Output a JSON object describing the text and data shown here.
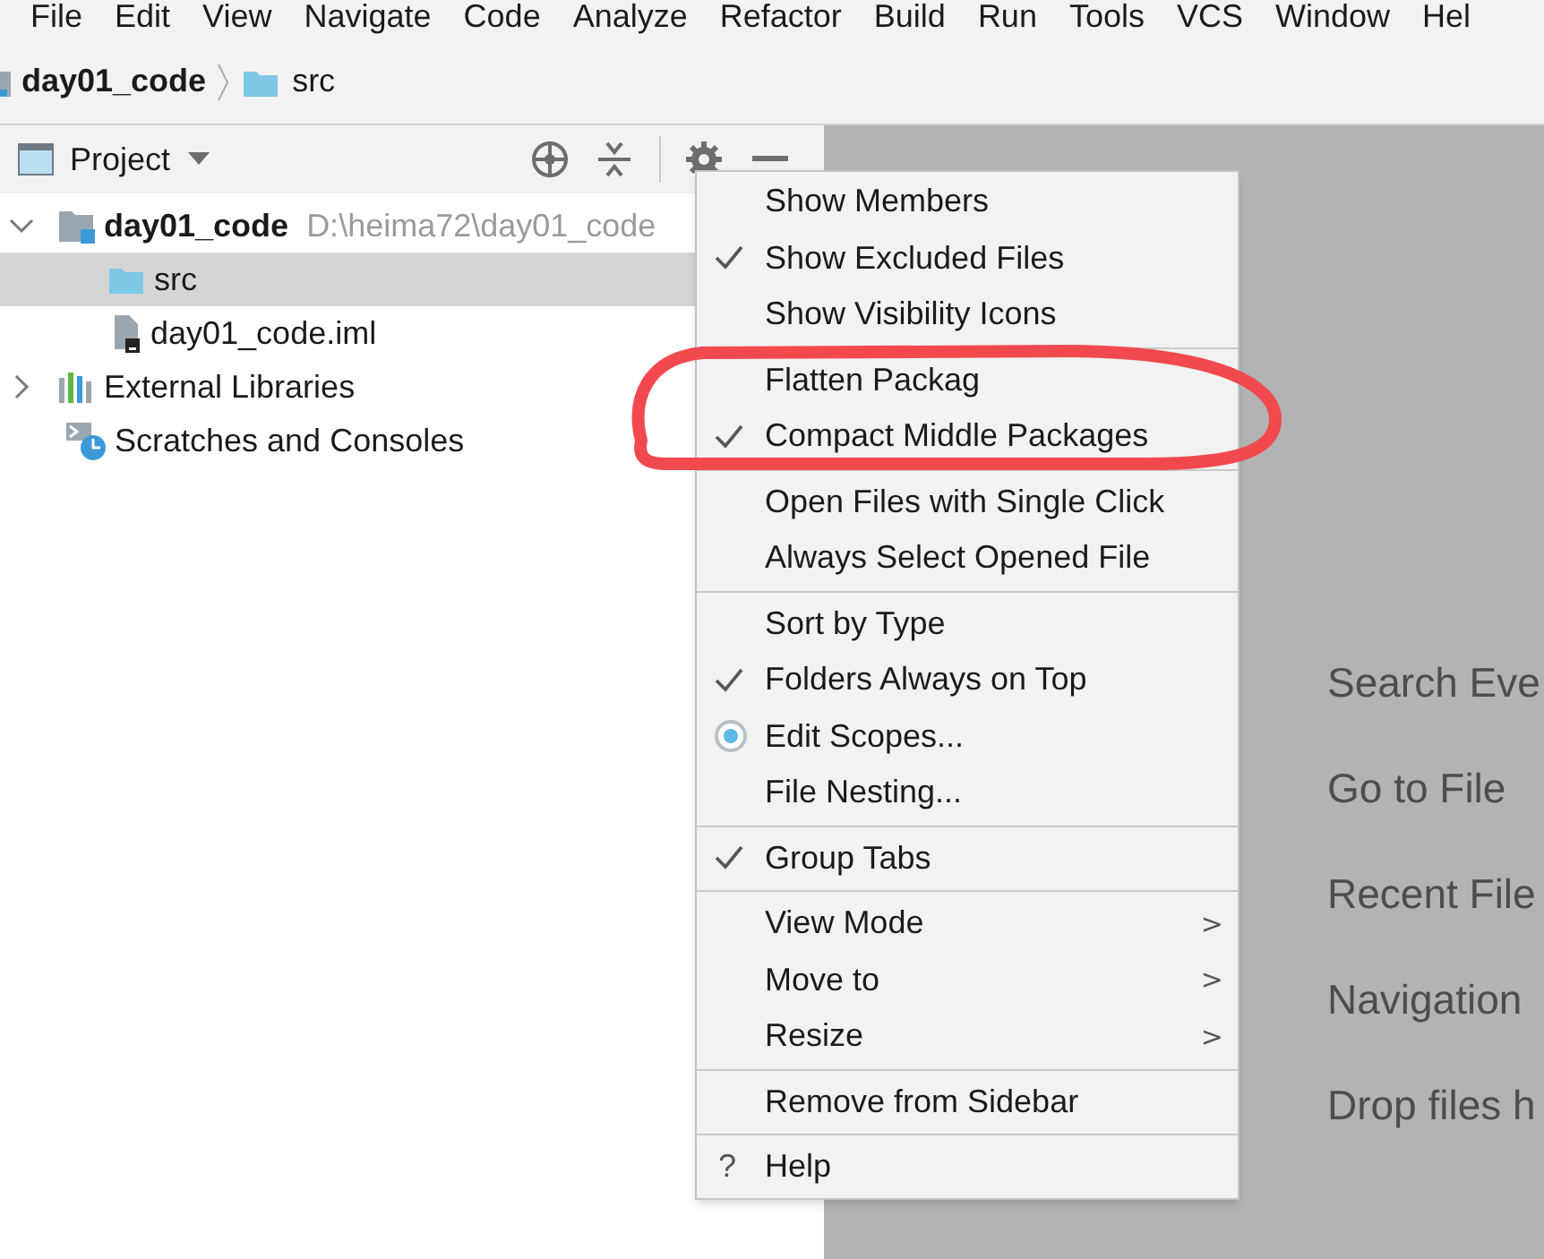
{
  "menu_bar": [
    "File",
    "Edit",
    "View",
    "Navigate",
    "Code",
    "Analyze",
    "Refactor",
    "Build",
    "Run",
    "Tools",
    "VCS",
    "Window",
    "Hel"
  ],
  "breadcrumb": [
    "day01_code",
    "src"
  ],
  "project_toolbar": {
    "title": "Project"
  },
  "tree": [
    {
      "kind": "module",
      "label": "day01_code",
      "path": "D:\\heima72\\day01_code",
      "expanded": true,
      "selected": false,
      "children": [
        {
          "kind": "folder",
          "label": "src",
          "selected": true
        },
        {
          "kind": "file",
          "label": "day01_code.iml",
          "selected": false
        }
      ]
    },
    {
      "kind": "libraries",
      "label": "External Libraries",
      "expanded": false,
      "selected": false
    },
    {
      "kind": "scratches",
      "label": "Scratches and Consoles",
      "selected": false
    }
  ],
  "context_menu": {
    "groups": [
      [
        {
          "kind": "check",
          "label": "Show Members",
          "checked": false
        },
        {
          "kind": "check",
          "label": "Show Excluded Files",
          "checked": true
        },
        {
          "kind": "check",
          "label": "Show Visibility Icons",
          "checked": false
        }
      ],
      [
        {
          "kind": "check",
          "label": "Flatten Packag",
          "checked": false
        },
        {
          "kind": "check",
          "label": "Compact Middle Packages",
          "checked": true
        }
      ],
      [
        {
          "kind": "check",
          "label": "Open Files with Single Click",
          "checked": false
        },
        {
          "kind": "check",
          "label": "Always Select Opened File",
          "checked": false
        }
      ],
      [
        {
          "kind": "check",
          "label": "Sort by Type",
          "checked": false
        },
        {
          "kind": "check",
          "label": "Folders Always on Top",
          "checked": true
        },
        {
          "kind": "radio",
          "label": "Edit Scopes...",
          "selected": true
        },
        {
          "kind": "check",
          "label": "File Nesting...",
          "checked": false
        }
      ],
      [
        {
          "kind": "check",
          "label": "Group Tabs",
          "checked": true
        }
      ],
      [
        {
          "kind": "submenu",
          "label": "View Mode",
          "arrow": ">"
        },
        {
          "kind": "submenu",
          "label": "Move to",
          "arrow": ">"
        },
        {
          "kind": "submenu",
          "label": "Resize",
          "arrow": ">"
        }
      ],
      [
        {
          "kind": "check",
          "label": "Remove from Sidebar",
          "checked": false
        }
      ],
      [
        {
          "kind": "help",
          "label": "Help",
          "icon": "?"
        }
      ]
    ]
  },
  "editor_hints": [
    "Search Eve",
    "Go to File",
    "Recent File",
    "Navigation",
    "Drop files h"
  ]
}
